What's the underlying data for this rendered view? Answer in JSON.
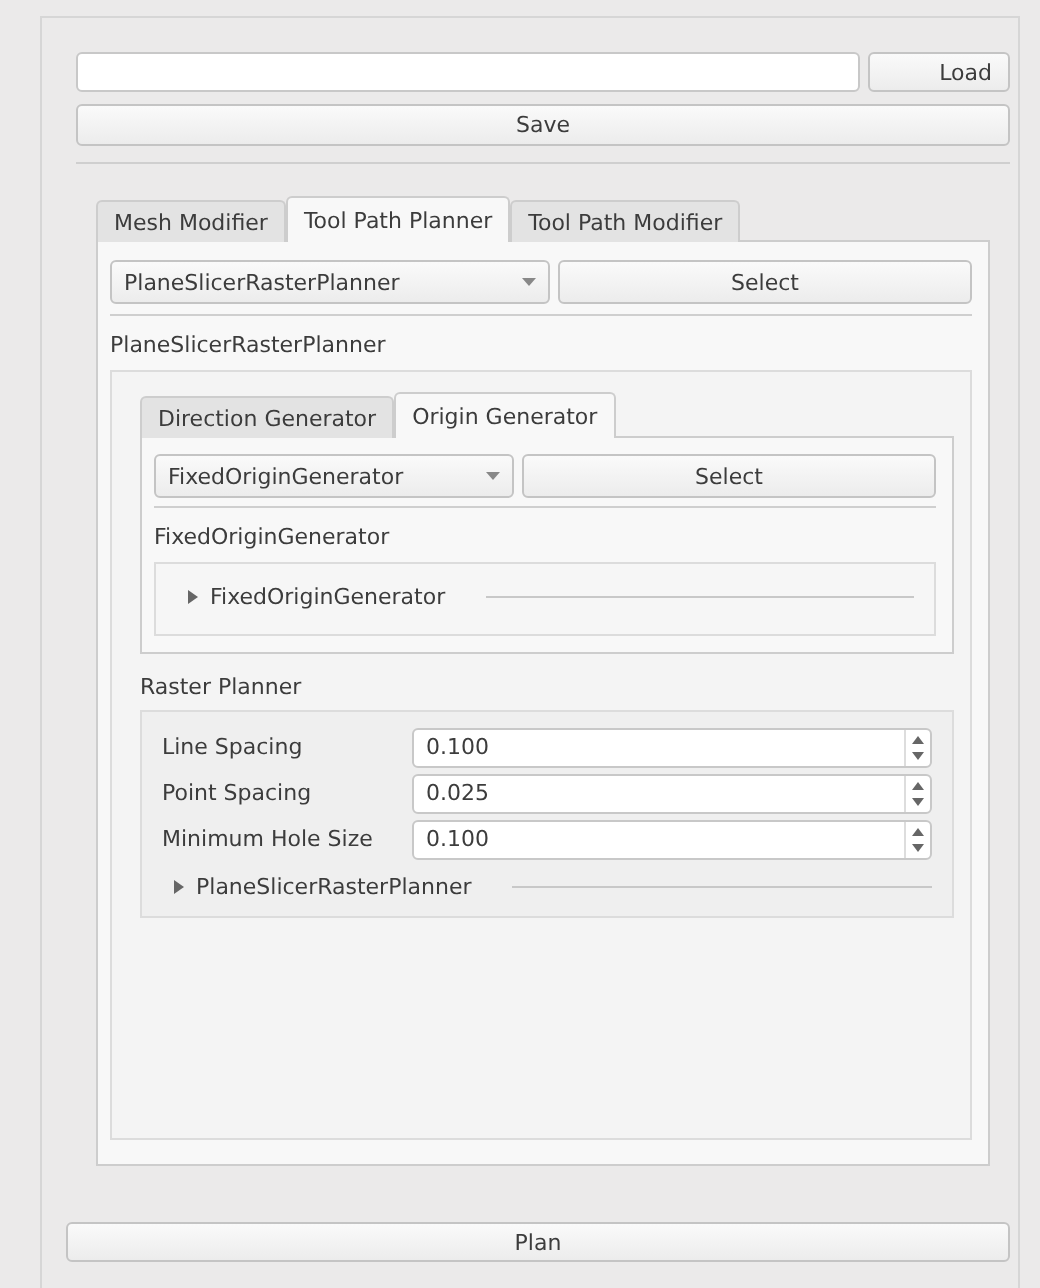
{
  "load_button": "Load",
  "save_button": "Save",
  "tabs": [
    {
      "label": "Mesh Modifier",
      "selected": false
    },
    {
      "label": "Tool Path Planner",
      "selected": true
    },
    {
      "label": "Tool Path Modifier",
      "selected": false
    }
  ],
  "planner": {
    "combo": "PlaneSlicerRasterPlanner",
    "select_button": "Select",
    "label": "PlaneSlicerRasterPlanner",
    "sub_tabs": [
      {
        "label": "Direction Generator",
        "selected": false
      },
      {
        "label": "Origin Generator",
        "selected": true
      }
    ],
    "origin": {
      "combo": "FixedOriginGenerator",
      "select_button": "Select",
      "label": "FixedOriginGenerator",
      "expander": {
        "label": "FixedOriginGenerator",
        "expanded": false
      }
    },
    "raster": {
      "title": "Raster Planner",
      "params": [
        {
          "label": "Line Spacing",
          "value": "0.100"
        },
        {
          "label": "Point Spacing",
          "value": "0.025"
        },
        {
          "label": "Minimum Hole Size",
          "value": "0.100"
        }
      ],
      "expander": {
        "label": "PlaneSlicerRasterPlanner",
        "expanded": false
      }
    }
  },
  "plan_button": "Plan"
}
